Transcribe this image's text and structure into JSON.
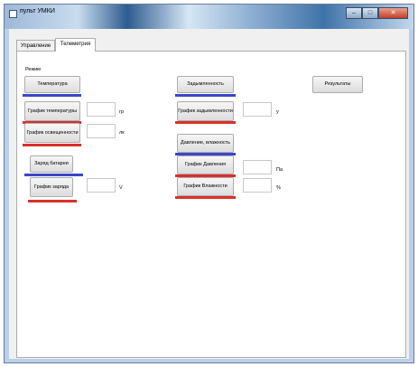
{
  "window": {
    "title": "пульт УМКИ"
  },
  "tabs": [
    "Управление",
    "Телеметрия"
  ],
  "panel": {
    "mode_label": "Режим",
    "buttons": {
      "temperature": "Температура",
      "temp_chart": "График температуры",
      "light_chart": "График освещенности",
      "battery": "Заряд батареи",
      "charge_chart": "График заряда",
      "smoke": "Задымленность",
      "smoke_chart": "График задымленности",
      "pressure_humidity": "Давление, влажность",
      "pressure_chart": "График Давления",
      "humidity_chart": "График Влажности",
      "results": "Результаты"
    },
    "units": {
      "temp": "гр",
      "light": "лк",
      "charge": "V",
      "smoke": "у",
      "pressure": "Па",
      "humidity": "%"
    }
  },
  "colors": {
    "blue_mark": "#3b46c9",
    "red_mark": "#d9302b"
  }
}
